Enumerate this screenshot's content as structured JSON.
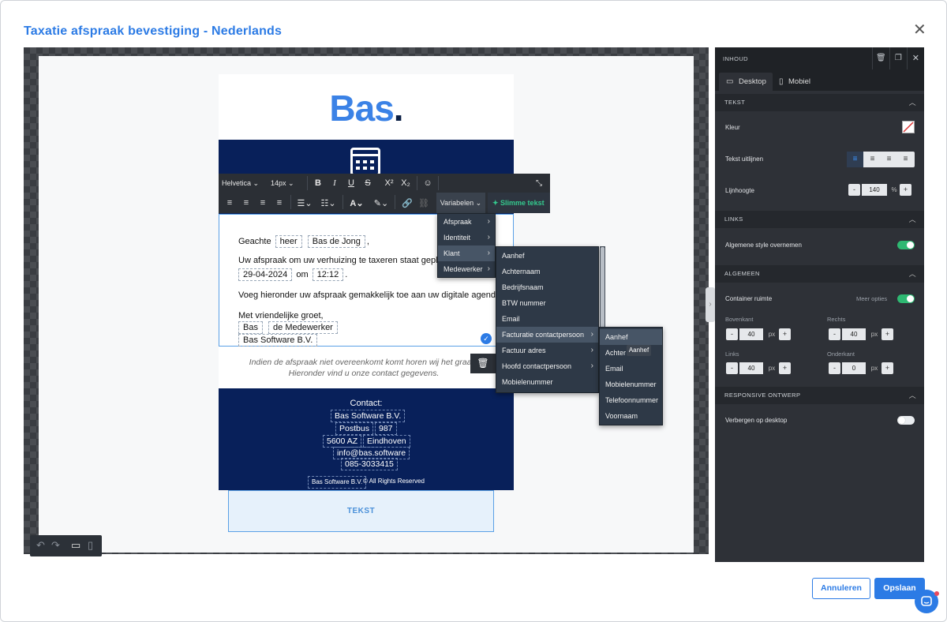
{
  "dialog": {
    "title": "Taxatie afspraak bevestiging - Nederlands"
  },
  "email": {
    "logo_text": "Bas",
    "logo_dot": ".",
    "greeting_prefix": "Geachte",
    "salutation_var": "heer",
    "name_var": "Bas de Jong",
    "greeting_suffix": ",",
    "appointment_text": "Uw afspraak om uw verhuizing te taxeren staat gepland o",
    "date_var": "29-04-2024",
    "date_join": "om",
    "time_var": "12:12",
    "time_suffix": ".",
    "calendar_text": "Voeg hieronder uw afspraak gemakkelijk toe aan uw digitale agenda.",
    "closing": "Met vriendelijke groet,",
    "sign_name_var": "Bas",
    "sign_role_var": "de Medewerker",
    "company_var": "Bas Software B.V.",
    "note_line1": "Indien de afspraak niet overeenkomt komt horen wij het graag.",
    "note_line2": "Hieronder vind u onze contact gegevens.",
    "contact_label": "Contact:",
    "contact_company": "Bas Software B.V.",
    "contact_street": "Postbus",
    "contact_number": "987",
    "contact_zip": "5600 AZ",
    "contact_city": "Eindhoven",
    "contact_email": "info@bas.software",
    "contact_phone": "085-3033415",
    "footer_company": "Bas Software B.V.",
    "footer_rights": "© All Rights Reserved",
    "text_block_label": "TEKST"
  },
  "toolbar": {
    "font": "Helvetica",
    "size": "14px",
    "variables_label": "Variabelen",
    "smart_text_label": "Slimme tekst"
  },
  "variables_menu": {
    "level1": [
      "Afspraak",
      "Identiteit",
      "Klant",
      "Medewerker"
    ],
    "level2": [
      "Aanhef",
      "Achternaam",
      "Bedrijfsnaam",
      "BTW nummer",
      "Email",
      "Facturatie contactpersoon",
      "Factuur adres",
      "Hoofd contactpersoon",
      "Mobielenummer"
    ],
    "level3": [
      "Aanhef",
      "Achter",
      "Email",
      "Mobielenummer",
      "Telefoonnummer",
      "Voornaam"
    ],
    "tooltip": "Aanhef"
  },
  "panel": {
    "header": "INHOUD",
    "tabs": [
      "Desktop",
      "Mobiel"
    ],
    "section_tekst": "TEKST",
    "kleur": "Kleur",
    "tekst_uitlijnen": "Tekst uitlijnen",
    "lijnhoogte": "Lijnhoogte",
    "lijnhoogte_value": "140",
    "lijnhoogte_unit": "%",
    "section_links": "LINKS",
    "algemene_style": "Algemene style overnemen",
    "section_algemeen": "ALGEMEEN",
    "container_ruimte": "Container ruimte",
    "meer_opties": "Meer opties",
    "bovenkant": "Bovenkant",
    "rechts": "Rechts",
    "links": "Links",
    "onderkant": "Onderkant",
    "bovenkant_value": "40",
    "rechts_value": "40",
    "links_value": "40",
    "onderkant_value": "0",
    "px": "px",
    "section_responsive": "RESPONSIVE ONTWERP",
    "verbergen_desktop": "Verbergen op desktop"
  },
  "footer": {
    "cancel": "Annuleren",
    "save": "Opslaan"
  },
  "colors": {
    "accent": "#2c7be5",
    "navy": "#08205a",
    "panel": "#2e3137",
    "toggle_on": "#2eb872",
    "smart_text": "#34c98e"
  }
}
